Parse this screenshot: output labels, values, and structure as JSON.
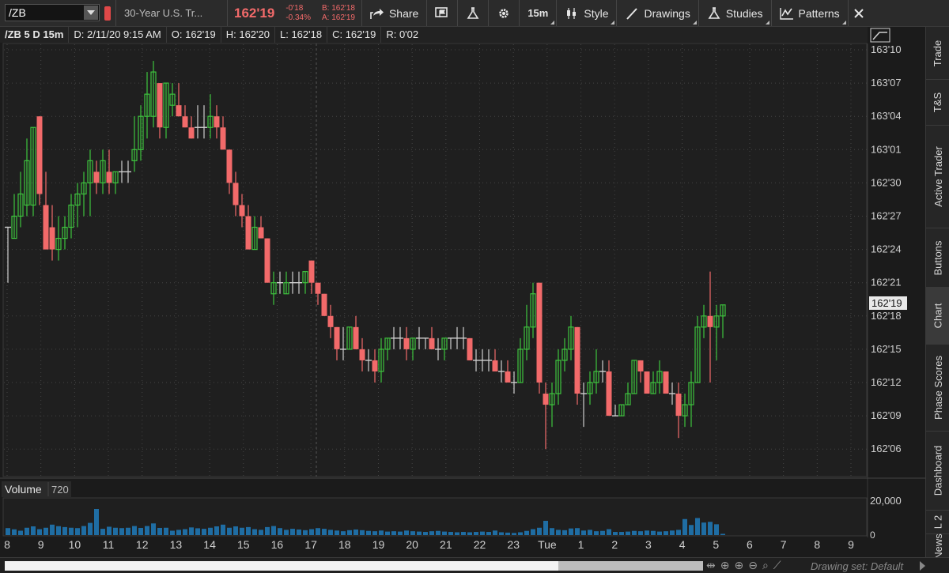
{
  "toolbar": {
    "symbol": "/ZB",
    "description": "30-Year U.S. Tr...",
    "last": "162'19",
    "net_change": "-0'18",
    "pct_change": "-0.34%",
    "bid": "B: 162'18",
    "ask": "A: 162'19",
    "share_label": "Share",
    "interval_label": "15m",
    "style_label": "Style",
    "drawings_label": "Drawings",
    "studies_label": "Studies",
    "patterns_label": "Patterns"
  },
  "info_bar": {
    "symbol_agg": "/ZB 5 D 15m",
    "date": "D: 2/11/20 9:15 AM",
    "open": "O: 162'19",
    "high": "H: 162'20",
    "low": "L: 162'18",
    "close": "C: 162'19",
    "range": "R: 0'02"
  },
  "volume_panel": {
    "label": "Volume",
    "value": "720",
    "axis_label": "20,000",
    "axis_zero": "0"
  },
  "price_badge": "162'19",
  "tabs": [
    "Trade",
    "T&S",
    "Active Trader",
    "Buttons",
    "Chart",
    "Phase Scores",
    "Dashboard",
    "L 2",
    "News"
  ],
  "active_tab": "Chart",
  "bottom_bar": {
    "drawing_set": "Drawing set: Default"
  },
  "colors": {
    "up": "#3ec43e",
    "down": "#f26a6a",
    "neutral": "#cfcfcf",
    "volume": "#1f6da3",
    "background": "#1b1b1b"
  },
  "chart_data": {
    "type": "candlestick",
    "price_axis": {
      "ticks": [
        "163'10",
        "163'07",
        "163'04",
        "163'01",
        "162'30",
        "162'27",
        "162'24",
        "162'21",
        "162'18",
        "162'15",
        "162'12",
        "162'09",
        "162'06"
      ],
      "ylim_ticks": [
        162.1875,
        163.3125
      ]
    },
    "time_axis": {
      "labels": [
        "8",
        "9",
        "10",
        "11",
        "12",
        "13",
        "14",
        "15",
        "16",
        "17",
        "18",
        "19",
        "20",
        "21",
        "22",
        "23",
        "Tue",
        "1",
        "2",
        "3",
        "4",
        "5",
        "6",
        "7",
        "8",
        "9"
      ]
    },
    "volume_axis": {
      "max": 20000
    },
    "candles": [
      {
        "o": 162.8125,
        "h": 162.8125,
        "l": 162.65625,
        "c": 162.8125,
        "v": 4000
      },
      {
        "o": 162.78125,
        "h": 162.90625,
        "l": 162.78125,
        "c": 162.84375,
        "v": 3300
      },
      {
        "o": 162.84375,
        "h": 162.96875,
        "l": 162.8125,
        "c": 162.90625,
        "v": 2500
      },
      {
        "o": 162.875,
        "h": 163.0625,
        "l": 162.84375,
        "c": 163.0,
        "v": 4200
      },
      {
        "o": 162.875,
        "h": 163.09375,
        "l": 162.84375,
        "c": 163.09375,
        "v": 5000
      },
      {
        "o": 163.125,
        "h": 163.125,
        "l": 162.875,
        "c": 162.90625,
        "v": 3400
      },
      {
        "o": 162.875,
        "h": 162.96875,
        "l": 162.75,
        "c": 162.75,
        "v": 4200
      },
      {
        "o": 162.8125,
        "h": 162.875,
        "l": 162.71875,
        "c": 162.75,
        "v": 6000
      },
      {
        "o": 162.75,
        "h": 162.84375,
        "l": 162.71875,
        "c": 162.78125,
        "v": 5100
      },
      {
        "o": 162.78125,
        "h": 162.84375,
        "l": 162.75,
        "c": 162.8125,
        "v": 4600
      },
      {
        "o": 162.8125,
        "h": 162.90625,
        "l": 162.78125,
        "c": 162.875,
        "v": 4200
      },
      {
        "o": 162.875,
        "h": 162.9375,
        "l": 162.8125,
        "c": 162.90625,
        "v": 4000
      },
      {
        "o": 162.90625,
        "h": 162.96875,
        "l": 162.84375,
        "c": 162.9375,
        "v": 5200
      },
      {
        "o": 162.9375,
        "h": 163.03125,
        "l": 162.84375,
        "c": 163.0,
        "v": 7000
      },
      {
        "o": 162.96875,
        "h": 163.0,
        "l": 162.90625,
        "c": 162.9375,
        "v": 15000
      },
      {
        "o": 162.9375,
        "h": 163.03125,
        "l": 162.90625,
        "c": 163.0,
        "v": 3600
      },
      {
        "o": 162.96875,
        "h": 163.03125,
        "l": 162.90625,
        "c": 162.9375,
        "v": 4800
      },
      {
        "o": 162.9375,
        "h": 162.96875,
        "l": 162.90625,
        "c": 162.96875,
        "v": 4200
      },
      {
        "o": 162.96875,
        "h": 163.0,
        "l": 162.9375,
        "c": 162.96875,
        "v": 4000
      },
      {
        "o": 162.96875,
        "h": 163.0,
        "l": 162.9375,
        "c": 162.96875,
        "v": 4200
      },
      {
        "o": 163.0,
        "h": 163.125,
        "l": 162.96875,
        "c": 163.03125,
        "v": 5200
      },
      {
        "o": 163.03125,
        "h": 163.15625,
        "l": 163.0,
        "c": 163.125,
        "v": 4100
      },
      {
        "o": 163.125,
        "h": 163.25,
        "l": 163.0625,
        "c": 163.1875,
        "v": 5200
      },
      {
        "o": 163.125,
        "h": 163.28125,
        "l": 163.09375,
        "c": 163.25,
        "v": 6700
      },
      {
        "o": 163.21875,
        "h": 163.21875,
        "l": 163.0625,
        "c": 163.09375,
        "v": 4100
      },
      {
        "o": 163.09375,
        "h": 163.21875,
        "l": 163.0625,
        "c": 163.21875,
        "v": 4200
      },
      {
        "o": 163.15625,
        "h": 163.21875,
        "l": 163.125,
        "c": 163.1875,
        "v": 2500
      },
      {
        "o": 163.15625,
        "h": 163.21875,
        "l": 163.125,
        "c": 163.125,
        "v": 3000
      },
      {
        "o": 163.125,
        "h": 163.15625,
        "l": 163.09375,
        "c": 163.09375,
        "v": 3400
      },
      {
        "o": 163.09375,
        "h": 163.125,
        "l": 163.0625,
        "c": 163.0625,
        "v": 4400
      },
      {
        "o": 163.09375,
        "h": 163.15625,
        "l": 163.0625,
        "c": 163.09375,
        "v": 3900
      },
      {
        "o": 163.09375,
        "h": 163.15625,
        "l": 163.0625,
        "c": 163.09375,
        "v": 3600
      },
      {
        "o": 163.09375,
        "h": 163.1875,
        "l": 163.0625,
        "c": 163.125,
        "v": 4200
      },
      {
        "o": 163.125,
        "h": 163.15625,
        "l": 163.0625,
        "c": 163.09375,
        "v": 5000
      },
      {
        "o": 163.09375,
        "h": 163.125,
        "l": 163.03125,
        "c": 163.03125,
        "v": 6000
      },
      {
        "o": 163.03125,
        "h": 163.03125,
        "l": 162.90625,
        "c": 162.9375,
        "v": 4200
      },
      {
        "o": 162.9375,
        "h": 162.96875,
        "l": 162.84375,
        "c": 162.875,
        "v": 5000
      },
      {
        "o": 162.875,
        "h": 162.90625,
        "l": 162.8125,
        "c": 162.84375,
        "v": 4200
      },
      {
        "o": 162.84375,
        "h": 162.875,
        "l": 162.75,
        "c": 162.75,
        "v": 4600
      },
      {
        "o": 162.75,
        "h": 162.84375,
        "l": 162.75,
        "c": 162.8125,
        "v": 3400
      },
      {
        "o": 162.8125,
        "h": 162.84375,
        "l": 162.78125,
        "c": 162.78125,
        "v": 3000
      },
      {
        "o": 162.78125,
        "h": 162.78125,
        "l": 162.65625,
        "c": 162.65625,
        "v": 4600
      },
      {
        "o": 162.625,
        "h": 162.6875,
        "l": 162.59375,
        "c": 162.65625,
        "v": 5200
      },
      {
        "o": 162.65625,
        "h": 162.6875,
        "l": 162.625,
        "c": 162.65625,
        "v": 4000
      },
      {
        "o": 162.625,
        "h": 162.6875,
        "l": 162.625,
        "c": 162.65625,
        "v": 3000
      },
      {
        "o": 162.65625,
        "h": 162.6875,
        "l": 162.625,
        "c": 162.65625,
        "v": 3600
      },
      {
        "o": 162.65625,
        "h": 162.6875,
        "l": 162.625,
        "c": 162.65625,
        "v": 3200
      },
      {
        "o": 162.65625,
        "h": 162.6875,
        "l": 162.625,
        "c": 162.6875,
        "v": 2800
      },
      {
        "o": 162.71875,
        "h": 162.71875,
        "l": 162.625,
        "c": 162.65625,
        "v": 3400
      },
      {
        "o": 162.65625,
        "h": 162.65625,
        "l": 162.59375,
        "c": 162.625,
        "v": 4000
      },
      {
        "o": 162.625,
        "h": 162.625,
        "l": 162.5625,
        "c": 162.5625,
        "v": 3600
      },
      {
        "o": 162.5625,
        "h": 162.59375,
        "l": 162.5,
        "c": 162.53125,
        "v": 3000
      },
      {
        "o": 162.53125,
        "h": 162.53125,
        "l": 162.4375,
        "c": 162.46875,
        "v": 2600
      },
      {
        "o": 162.46875,
        "h": 162.53125,
        "l": 162.4375,
        "c": 162.46875,
        "v": 2200
      },
      {
        "o": 162.46875,
        "h": 162.53125,
        "l": 162.46875,
        "c": 162.53125,
        "v": 2800
      },
      {
        "o": 162.53125,
        "h": 162.5625,
        "l": 162.46875,
        "c": 162.46875,
        "v": 3200
      },
      {
        "o": 162.46875,
        "h": 162.5,
        "l": 162.40625,
        "c": 162.4375,
        "v": 2800
      },
      {
        "o": 162.4375,
        "h": 162.46875,
        "l": 162.40625,
        "c": 162.4375,
        "v": 2400
      },
      {
        "o": 162.4375,
        "h": 162.46875,
        "l": 162.375,
        "c": 162.40625,
        "v": 2200
      },
      {
        "o": 162.40625,
        "h": 162.5,
        "l": 162.375,
        "c": 162.46875,
        "v": 2600
      },
      {
        "o": 162.46875,
        "h": 162.5,
        "l": 162.4375,
        "c": 162.5,
        "v": 2000
      },
      {
        "o": 162.5,
        "h": 162.53125,
        "l": 162.46875,
        "c": 162.5,
        "v": 2200
      },
      {
        "o": 162.5,
        "h": 162.53125,
        "l": 162.46875,
        "c": 162.5,
        "v": 2000
      },
      {
        "o": 162.5,
        "h": 162.53125,
        "l": 162.4375,
        "c": 162.46875,
        "v": 2600
      },
      {
        "o": 162.46875,
        "h": 162.5,
        "l": 162.4375,
        "c": 162.5,
        "v": 2200
      },
      {
        "o": 162.5,
        "h": 162.53125,
        "l": 162.46875,
        "c": 162.5,
        "v": 2000
      },
      {
        "o": 162.5,
        "h": 162.5,
        "l": 162.46875,
        "c": 162.5,
        "v": 1800
      },
      {
        "o": 162.5,
        "h": 162.53125,
        "l": 162.46875,
        "c": 162.46875,
        "v": 2200
      },
      {
        "o": 162.46875,
        "h": 162.5,
        "l": 162.4375,
        "c": 162.46875,
        "v": 2400
      },
      {
        "o": 162.46875,
        "h": 162.5,
        "l": 162.4375,
        "c": 162.5,
        "v": 2000
      },
      {
        "o": 162.5,
        "h": 162.5,
        "l": 162.46875,
        "c": 162.5,
        "v": 1800
      },
      {
        "o": 162.5,
        "h": 162.53125,
        "l": 162.46875,
        "c": 162.5,
        "v": 1600
      },
      {
        "o": 162.5,
        "h": 162.53125,
        "l": 162.46875,
        "c": 162.5,
        "v": 1800
      },
      {
        "o": 162.5,
        "h": 162.5,
        "l": 162.4375,
        "c": 162.4375,
        "v": 1600
      },
      {
        "o": 162.4375,
        "h": 162.46875,
        "l": 162.40625,
        "c": 162.4375,
        "v": 1800
      },
      {
        "o": 162.4375,
        "h": 162.46875,
        "l": 162.40625,
        "c": 162.4375,
        "v": 2000
      },
      {
        "o": 162.4375,
        "h": 162.46875,
        "l": 162.40625,
        "c": 162.4375,
        "v": 1800
      },
      {
        "o": 162.4375,
        "h": 162.46875,
        "l": 162.40625,
        "c": 162.40625,
        "v": 2600
      },
      {
        "o": 162.40625,
        "h": 162.4375,
        "l": 162.375,
        "c": 162.40625,
        "v": 1600
      },
      {
        "o": 162.40625,
        "h": 162.4375,
        "l": 162.375,
        "c": 162.375,
        "v": 1400
      },
      {
        "o": 162.375,
        "h": 162.40625,
        "l": 162.34375,
        "c": 162.375,
        "v": 1200
      },
      {
        "o": 162.375,
        "h": 162.5,
        "l": 162.375,
        "c": 162.46875,
        "v": 1600
      },
      {
        "o": 162.46875,
        "h": 162.59375,
        "l": 162.4375,
        "c": 162.53125,
        "v": 2400
      },
      {
        "o": 162.53125,
        "h": 162.65625,
        "l": 162.5,
        "c": 162.625,
        "v": 3400
      },
      {
        "o": 162.65625,
        "h": 162.65625,
        "l": 162.34375,
        "c": 162.375,
        "v": 4200
      },
      {
        "o": 162.34375,
        "h": 162.375,
        "l": 162.1875,
        "c": 162.3125,
        "v": 8200
      },
      {
        "o": 162.3125,
        "h": 162.375,
        "l": 162.25,
        "c": 162.34375,
        "v": 4000
      },
      {
        "o": 162.34375,
        "h": 162.46875,
        "l": 162.3125,
        "c": 162.4375,
        "v": 3000
      },
      {
        "o": 162.4375,
        "h": 162.5,
        "l": 162.40625,
        "c": 162.46875,
        "v": 2800
      },
      {
        "o": 162.46875,
        "h": 162.5625,
        "l": 162.4375,
        "c": 162.53125,
        "v": 3800
      },
      {
        "o": 162.53125,
        "h": 162.53125,
        "l": 162.3125,
        "c": 162.34375,
        "v": 4000
      },
      {
        "o": 162.34375,
        "h": 162.375,
        "l": 162.25,
        "c": 162.34375,
        "v": 2600
      },
      {
        "o": 162.34375,
        "h": 162.40625,
        "l": 162.3125,
        "c": 162.375,
        "v": 3000
      },
      {
        "o": 162.375,
        "h": 162.46875,
        "l": 162.34375,
        "c": 162.40625,
        "v": 2200
      },
      {
        "o": 162.40625,
        "h": 162.4375,
        "l": 162.375,
        "c": 162.40625,
        "v": 2400
      },
      {
        "o": 162.40625,
        "h": 162.4375,
        "l": 162.28125,
        "c": 162.28125,
        "v": 3400
      },
      {
        "o": 162.28125,
        "h": 162.3125,
        "l": 162.28125,
        "c": 162.28125,
        "v": 1800
      },
      {
        "o": 162.28125,
        "h": 162.3125,
        "l": 162.28125,
        "c": 162.3125,
        "v": 1800
      },
      {
        "o": 162.3125,
        "h": 162.375,
        "l": 162.3125,
        "c": 162.34375,
        "v": 2000
      },
      {
        "o": 162.34375,
        "h": 162.4375,
        "l": 162.34375,
        "c": 162.4375,
        "v": 2400
      },
      {
        "o": 162.4375,
        "h": 162.4375,
        "l": 162.375,
        "c": 162.40625,
        "v": 2200
      },
      {
        "o": 162.40625,
        "h": 162.40625,
        "l": 162.34375,
        "c": 162.34375,
        "v": 2600
      },
      {
        "o": 162.34375,
        "h": 162.40625,
        "l": 162.34375,
        "c": 162.375,
        "v": 2400
      },
      {
        "o": 162.375,
        "h": 162.4375,
        "l": 162.34375,
        "c": 162.40625,
        "v": 2000
      },
      {
        "o": 162.40625,
        "h": 162.40625,
        "l": 162.34375,
        "c": 162.34375,
        "v": 2200
      },
      {
        "o": 162.34375,
        "h": 162.375,
        "l": 162.3125,
        "c": 162.34375,
        "v": 2600
      },
      {
        "o": 162.34375,
        "h": 162.375,
        "l": 162.21875,
        "c": 162.28125,
        "v": 3000
      },
      {
        "o": 162.28125,
        "h": 162.34375,
        "l": 162.25,
        "c": 162.3125,
        "v": 9200
      },
      {
        "o": 162.3125,
        "h": 162.40625,
        "l": 162.25,
        "c": 162.375,
        "v": 5800
      },
      {
        "o": 162.375,
        "h": 162.5625,
        "l": 162.375,
        "c": 162.53125,
        "v": 9800
      },
      {
        "o": 162.53125,
        "h": 162.59375,
        "l": 162.5,
        "c": 162.5625,
        "v": 7200
      },
      {
        "o": 162.5625,
        "h": 162.6875,
        "l": 162.375,
        "c": 162.53125,
        "v": 7600
      },
      {
        "o": 162.53125,
        "h": 162.59375,
        "l": 162.4375,
        "c": 162.5625,
        "v": 6200
      },
      {
        "o": 162.5625,
        "h": 162.59375,
        "l": 162.5,
        "c": 162.59375,
        "v": 720
      }
    ]
  }
}
